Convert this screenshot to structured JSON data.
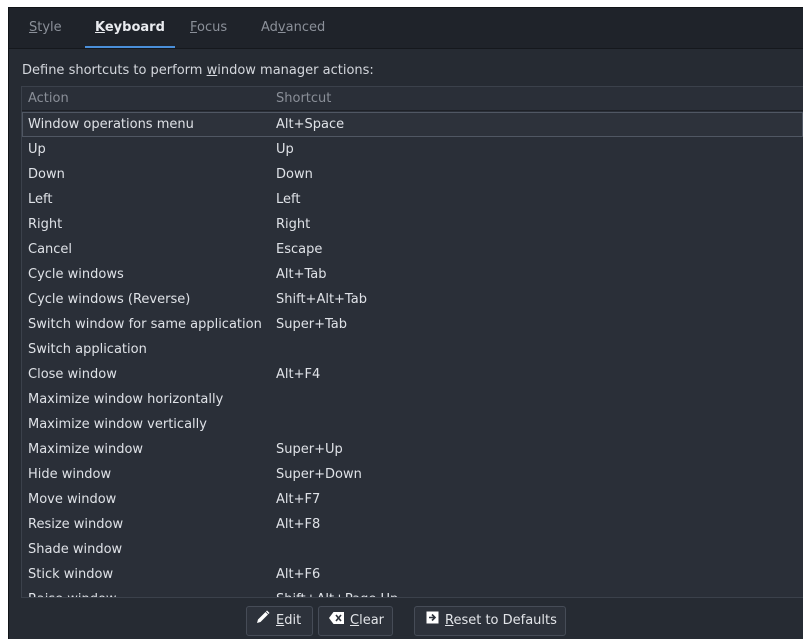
{
  "tabs": [
    {
      "label_pre": "",
      "mnemonic": "S",
      "label_post": "tyle"
    },
    {
      "label_pre": "",
      "mnemonic": "K",
      "label_post": "eyboard"
    },
    {
      "label_pre": "",
      "mnemonic": "F",
      "label_post": "ocus"
    },
    {
      "label_pre": "Ad",
      "mnemonic": "v",
      "label_post": "anced"
    }
  ],
  "active_tab": "Keyboard",
  "description": {
    "pre": "Define shortcuts to perform ",
    "mnemonic": "w",
    "post": "indow manager actions:"
  },
  "columns": {
    "action": "Action",
    "shortcut": "Shortcut"
  },
  "rows": [
    {
      "action": "Window operations menu",
      "shortcut": "Alt+Space"
    },
    {
      "action": "Up",
      "shortcut": "Up"
    },
    {
      "action": "Down",
      "shortcut": "Down"
    },
    {
      "action": "Left",
      "shortcut": "Left"
    },
    {
      "action": "Right",
      "shortcut": "Right"
    },
    {
      "action": "Cancel",
      "shortcut": "Escape"
    },
    {
      "action": "Cycle windows",
      "shortcut": "Alt+Tab"
    },
    {
      "action": "Cycle windows (Reverse)",
      "shortcut": "Shift+Alt+Tab"
    },
    {
      "action": "Switch window for same application",
      "shortcut": "Super+Tab"
    },
    {
      "action": "Switch application",
      "shortcut": ""
    },
    {
      "action": "Close window",
      "shortcut": "Alt+F4"
    },
    {
      "action": "Maximize window horizontally",
      "shortcut": ""
    },
    {
      "action": "Maximize window vertically",
      "shortcut": ""
    },
    {
      "action": "Maximize window",
      "shortcut": "Super+Up"
    },
    {
      "action": "Hide window",
      "shortcut": "Super+Down"
    },
    {
      "action": "Move window",
      "shortcut": "Alt+F7"
    },
    {
      "action": "Resize window",
      "shortcut": "Alt+F8"
    },
    {
      "action": "Shade window",
      "shortcut": ""
    },
    {
      "action": "Stick window",
      "shortcut": "Alt+F6"
    },
    {
      "action": "Raise window",
      "shortcut": "Shift+Alt+Page Up"
    }
  ],
  "selected_row": "Window operations menu",
  "buttons": {
    "edit": {
      "pre": "",
      "mnemonic": "E",
      "post": "dit",
      "icon": "pencil-icon"
    },
    "clear": {
      "pre": "",
      "mnemonic": "C",
      "post": "lear",
      "icon": "backspace-icon"
    },
    "reset": {
      "pre": "",
      "mnemonic": "R",
      "post": "eset to Defaults",
      "icon": "reset-icon"
    }
  },
  "colors": {
    "accent": "#4a8fd9",
    "background": "#262b33",
    "list_bg": "#2a2f38"
  }
}
